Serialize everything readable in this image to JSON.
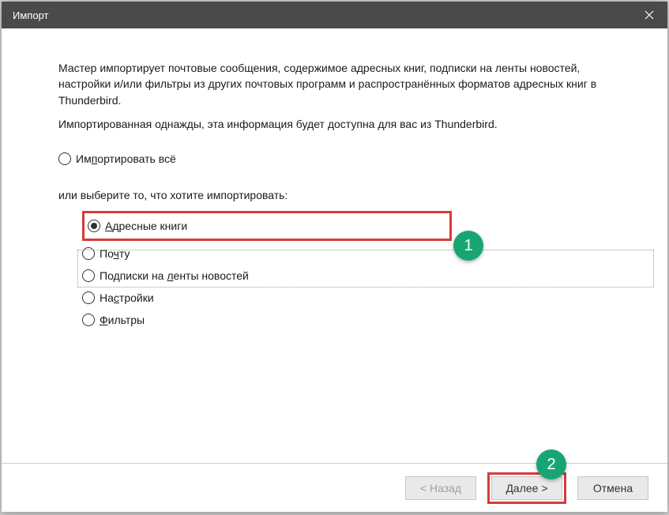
{
  "window": {
    "title": "Импорт"
  },
  "content": {
    "intro1": "Мастер импортирует почтовые сообщения, содержимое адресных книг, подписки на ленты новостей, настройки и/или фильтры из других почтовых программ и распространённых форматов адресных книг в Thunderbird.",
    "intro2": "Импортированная однажды, эта информация будет доступна для вас из Thunderbird.",
    "importAll": "Импортировать всё",
    "subPrompt": "или выберите то, что хотите импортировать:",
    "options": {
      "addressBooks": "Адресные книги",
      "mail": "Почту",
      "feeds": "Подписки на ленты новостей",
      "settings": "Настройки",
      "filters": "Фильтры"
    }
  },
  "buttons": {
    "back": "< Назад",
    "next": "Далее >",
    "cancel": "Отмена"
  },
  "annotations": {
    "badge1": "1",
    "badge2": "2"
  }
}
